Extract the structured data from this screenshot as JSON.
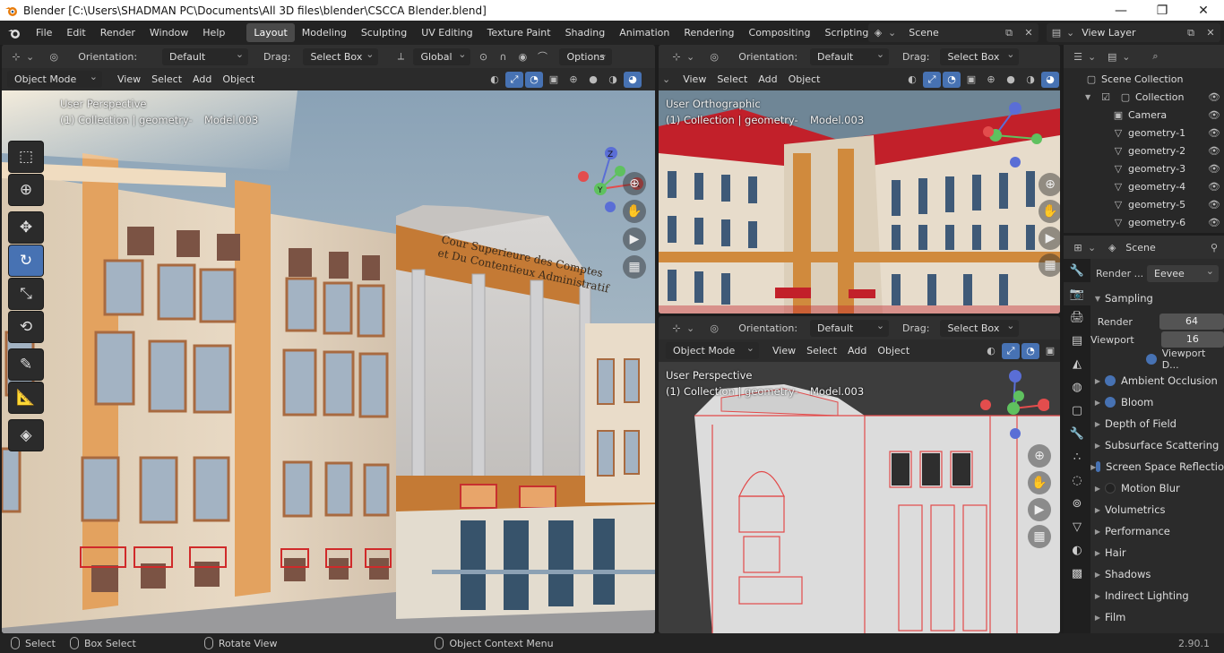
{
  "window": {
    "title": "Blender [C:\\Users\\SHADMAN PC\\Documents\\All 3D files\\blender\\CSCCA Blender.blend]",
    "min": "—",
    "max": "❐",
    "close": "✕"
  },
  "menubar": {
    "items": [
      "File",
      "Edit",
      "Render",
      "Window",
      "Help"
    ]
  },
  "workspaces": [
    "Layout",
    "Modeling",
    "Sculpting",
    "UV Editing",
    "Texture Paint",
    "Shading",
    "Animation",
    "Rendering",
    "Compositing",
    "Scripting"
  ],
  "active_workspace": "Layout",
  "add_workspace": "+",
  "scene": {
    "label": "Scene"
  },
  "view_layer": {
    "label": "View Layer"
  },
  "main_view": {
    "orientation_label": "Orientation:",
    "orientation": "Default",
    "drag_label": "Drag:",
    "drag": "Select Box",
    "transform": "Global",
    "options": "Options",
    "mode": "Object Mode",
    "menus": [
      "View",
      "Select",
      "Add",
      "Object"
    ],
    "line1": "User Perspective",
    "line2": "(1) Collection | geometry-",
    "line2b": "Model.003"
  },
  "topright_view": {
    "orientation_label": "Orientation:",
    "orientation": "Default",
    "drag_label": "Drag:",
    "drag": "Select Box",
    "menus": [
      "View",
      "Select",
      "Add",
      "Object"
    ],
    "line1": "User Orthographic",
    "line2": "(1) Collection | geometry-",
    "line2b": "Model.003"
  },
  "bottomright_view": {
    "orientation_label": "Orientation:",
    "orientation": "Default",
    "drag_label": "Drag:",
    "drag": "Select Box",
    "mode": "Object Mode",
    "menus": [
      "View",
      "Select",
      "Add",
      "Object"
    ],
    "line1": "User Perspective",
    "line2": "(1) Collection | geometry-",
    "line2b": "Model.003"
  },
  "building_sign": {
    "line1": "Cour Superieure des Comptes",
    "line2": "et Du Contentieux Administratif"
  },
  "outliner": {
    "root": "Scene Collection",
    "collection": "Collection",
    "items": [
      "Camera",
      "geometry-1",
      "geometry-2",
      "geometry-3",
      "geometry-4",
      "geometry-5",
      "geometry-6"
    ]
  },
  "properties": {
    "context": "Scene",
    "render_engine_label": "Render ...",
    "render_engine": "Eevee",
    "sampling": "Sampling",
    "render_label": "Render",
    "render_value": "64",
    "viewport_label": "Viewport",
    "viewport_value": "16",
    "viewport_denoise": "Viewport D...",
    "sections": [
      {
        "label": "Ambient Occlusion",
        "toggle": "on"
      },
      {
        "label": "Bloom",
        "toggle": "on"
      },
      {
        "label": "Depth of Field",
        "toggle": "none"
      },
      {
        "label": "Subsurface Scattering",
        "toggle": "none"
      },
      {
        "label": "Screen Space Reflectio",
        "toggle": "on"
      },
      {
        "label": "Motion Blur",
        "toggle": "off"
      },
      {
        "label": "Volumetrics",
        "toggle": "none"
      },
      {
        "label": "Performance",
        "toggle": "none"
      },
      {
        "label": "Hair",
        "toggle": "none"
      },
      {
        "label": "Shadows",
        "toggle": "none"
      },
      {
        "label": "Indirect Lighting",
        "toggle": "none"
      },
      {
        "label": "Film",
        "toggle": "none"
      }
    ]
  },
  "statusbar": {
    "select": "Select",
    "box_select": "Box Select",
    "rotate": "Rotate View",
    "context_menu": "Object Context Menu",
    "version": "2.90.1"
  },
  "gizmo": {
    "x": "X",
    "y": "Y",
    "z": "Z"
  },
  "colors": {
    "accent": "#4772b3",
    "x_axis": "#e34d4d",
    "y_axis": "#5fc15f",
    "z_axis": "#5a6ed6"
  }
}
